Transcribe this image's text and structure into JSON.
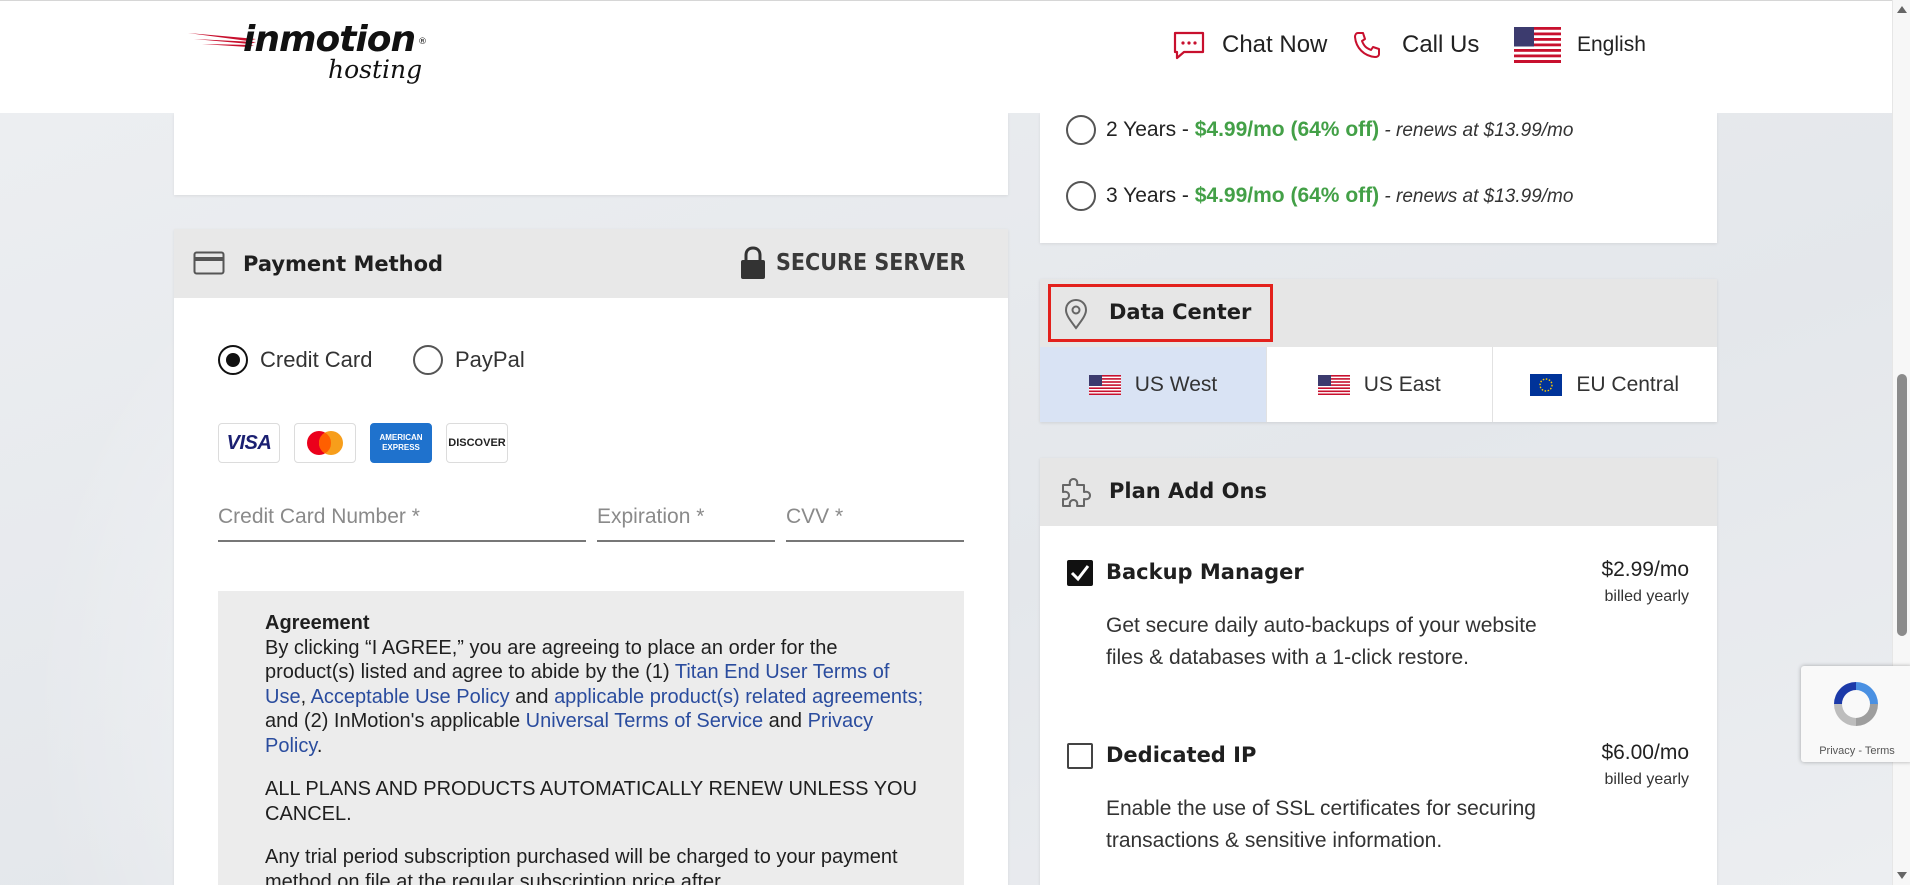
{
  "header": {
    "logo_word": "inmotion",
    "logo_sub": "hosting",
    "logo_mark": "®",
    "chat_label": "Chat Now",
    "call_label": "Call Us",
    "language": "English"
  },
  "term_options": [
    {
      "term": "2 Years - ",
      "price": "$4.99/mo (64% off)",
      "renew": " - renews at $13.99/mo",
      "selected": false
    },
    {
      "term": "3 Years - ",
      "price": "$4.99/mo (64% off)",
      "renew": " - renews at $13.99/mo",
      "selected": false
    }
  ],
  "payment": {
    "title": "Payment Method",
    "secure_label": "SECURE SERVER",
    "methods": [
      "Credit Card",
      "PayPal"
    ],
    "selected_method": "Credit Card",
    "card_brands": {
      "visa": "VISA",
      "amex": "AMERICAN EXPRESS",
      "discover": "DISCOVER"
    },
    "fields": {
      "card_number": "Credit Card Number *",
      "expiration": "Expiration *",
      "cvv": "CVV *"
    }
  },
  "agreement": {
    "title": "Agreement",
    "p1_a": "By clicking “I AGREE,” you are agreeing to place an order for the product(s) listed and agree to abide by the (1) ",
    "link_titan": "Titan End User Terms of Use",
    "sep1": ", ",
    "link_aup": "Acceptable Use Policy",
    "and1": " and ",
    "link_related": "applicable product(s) related agreements;",
    "p1_b": " and (2) InMotion's applicable ",
    "link_tos": "Universal Terms of Service",
    "and2": " and ",
    "link_privacy": "Privacy Policy",
    "period": ".",
    "p2": "ALL PLANS AND PRODUCTS AUTOMATICALLY RENEW UNLESS YOU CANCEL.",
    "p3": "Any trial period subscription purchased will be charged to your payment method on file at the regular subscription price after"
  },
  "data_center": {
    "title": "Data Center",
    "options": [
      "US West",
      "US East",
      "EU Central"
    ],
    "selected": "US West"
  },
  "addons": {
    "title": "Plan Add Ons",
    "items": [
      {
        "name": "Backup Manager",
        "price": "$2.99/mo",
        "billing": "billed yearly",
        "desc": "Get secure daily auto-backups of your website files & databases with a 1-click restore.",
        "checked": true
      },
      {
        "name": "Dedicated IP",
        "price": "$6.00/mo",
        "billing": "billed yearly",
        "desc": "Enable the use of SSL certificates for securing transactions & sensitive information.",
        "checked": false
      }
    ]
  },
  "recaptcha": {
    "links": "Privacy - Terms"
  },
  "colors": {
    "accent_red": "#c8102e",
    "green": "#43a047",
    "link_blue": "#2a4c9e",
    "highlight": "#e3211c",
    "selected_bg": "#d9e3f4"
  }
}
